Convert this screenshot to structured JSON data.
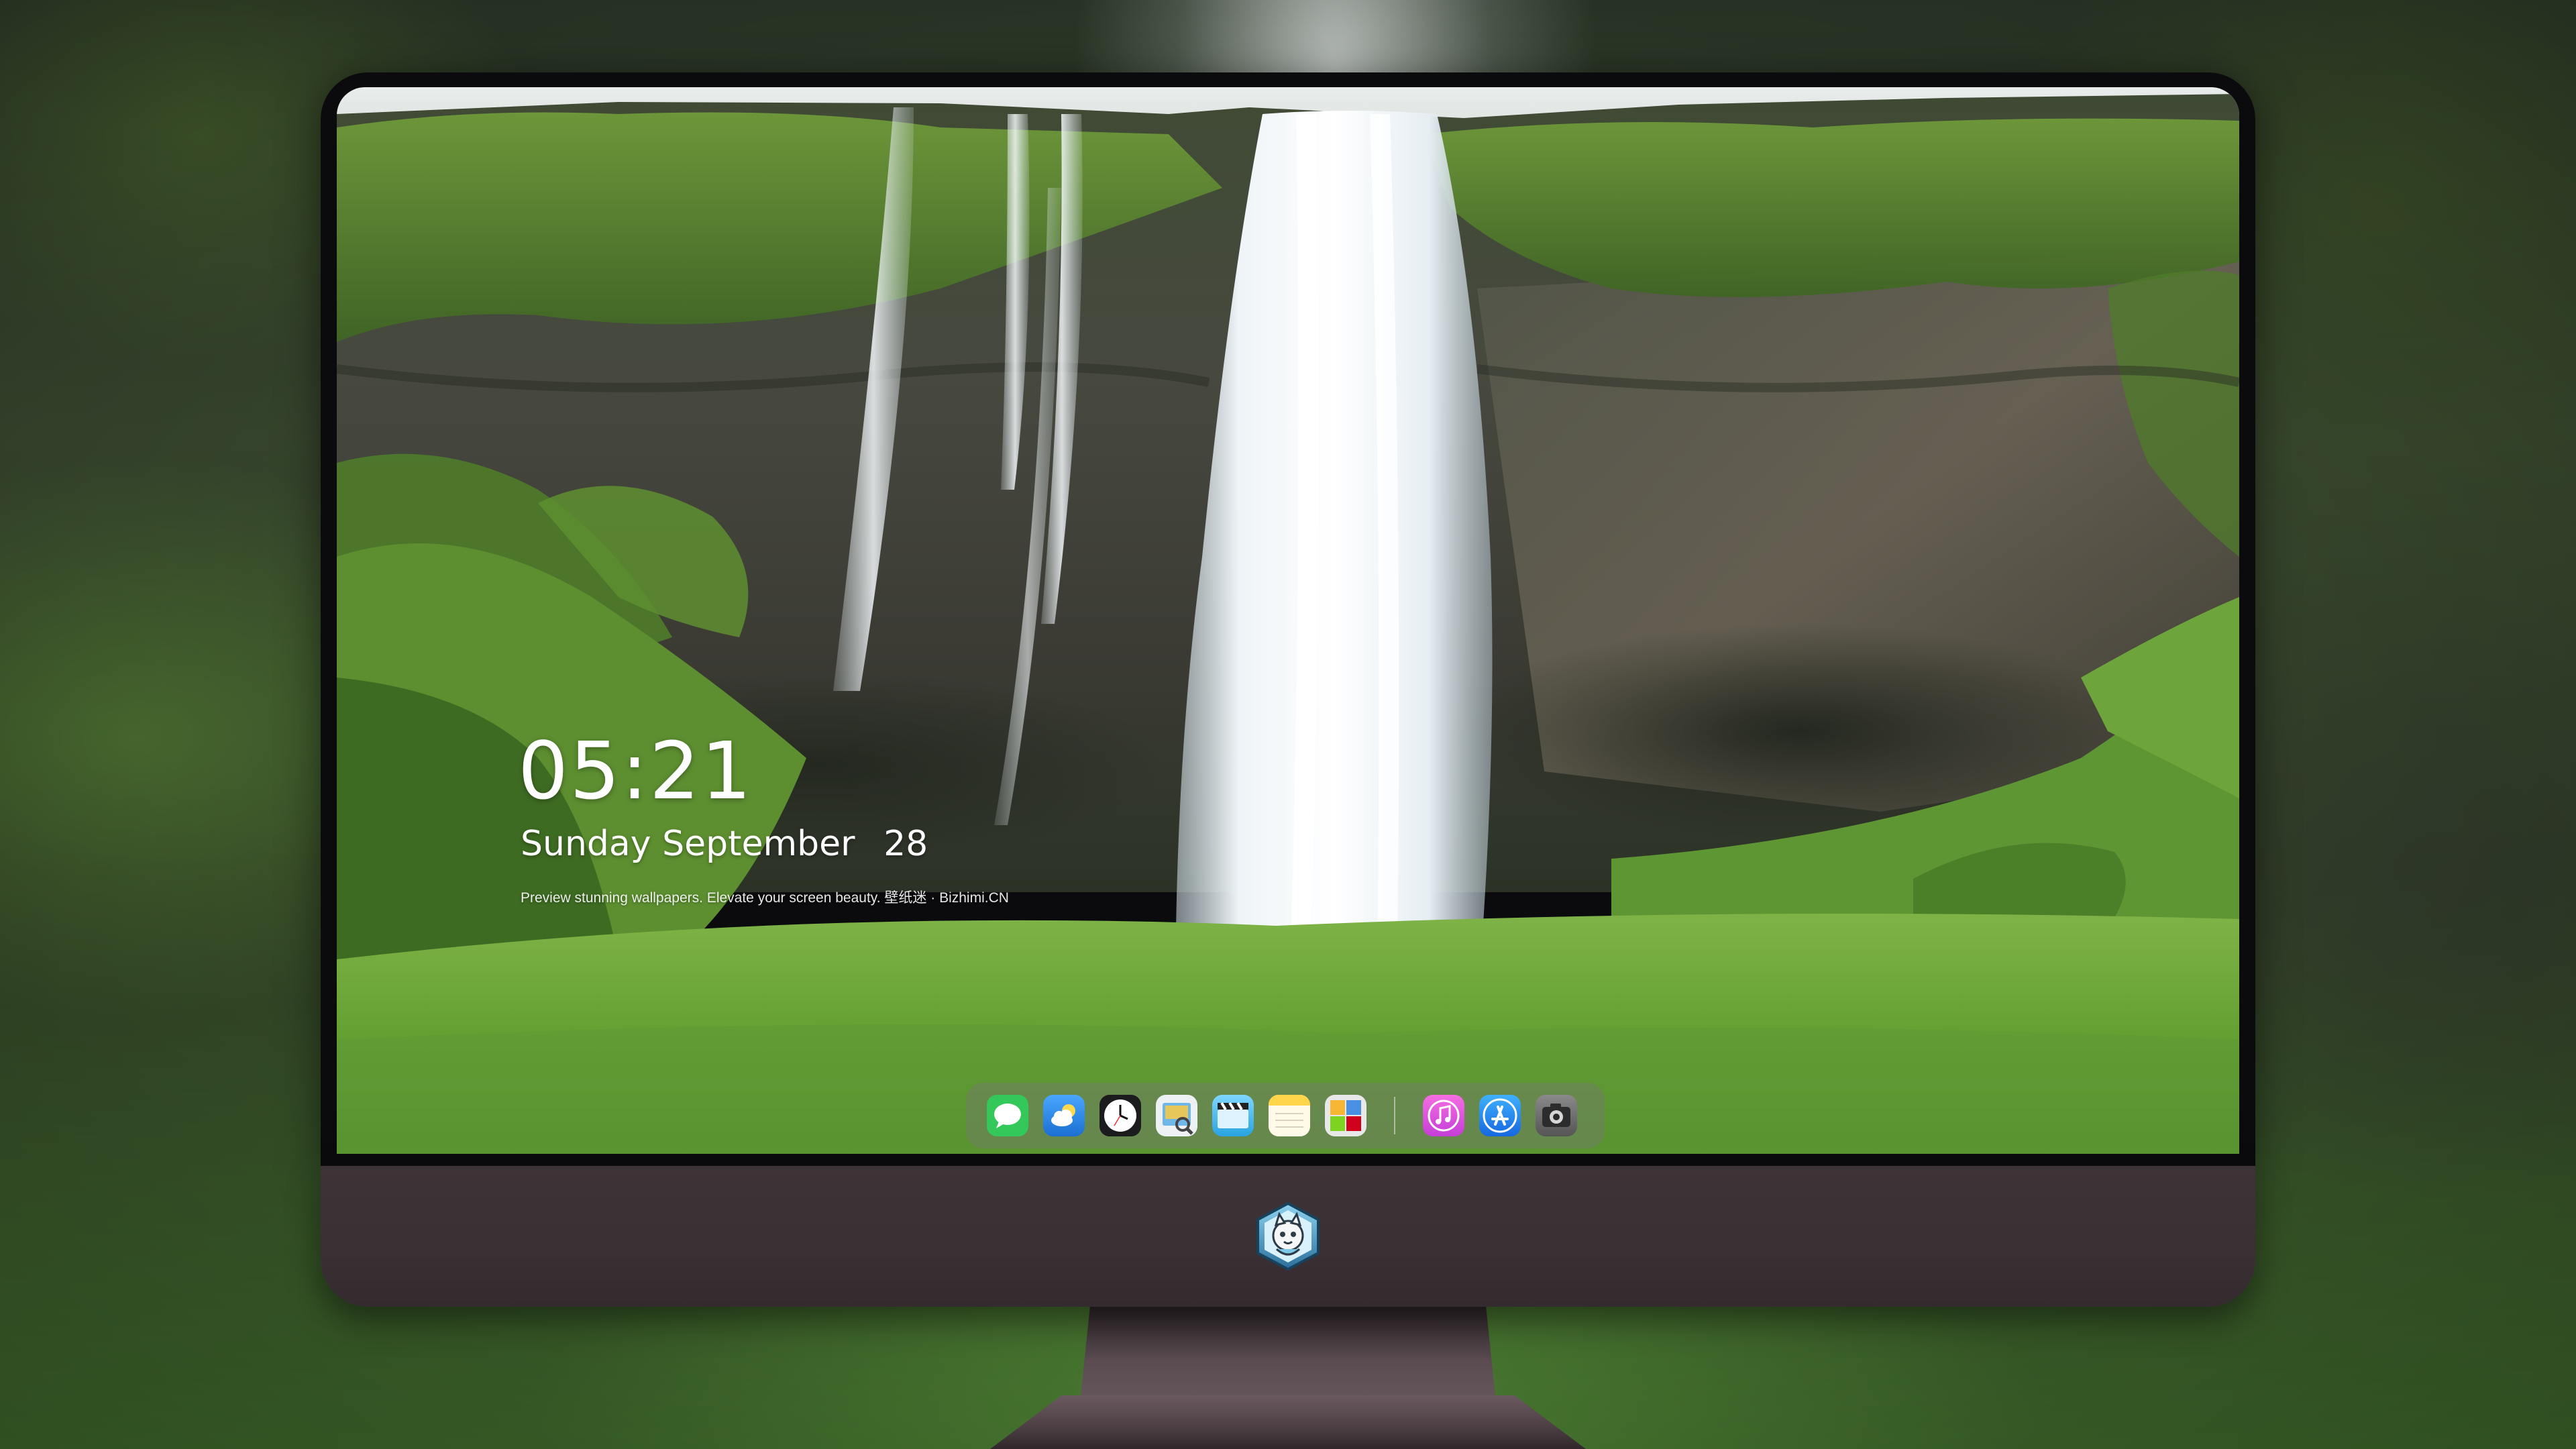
{
  "lock_screen": {
    "time": "05:21",
    "day_of_week": "Sunday",
    "month": "September",
    "day": "28",
    "tagline": "Preview stunning wallpapers. Elevate your screen beauty. 壁纸迷 · Bizhimi.CN"
  },
  "dock": {
    "apps": [
      {
        "icon": "messages-icon",
        "color": "#34c759"
      },
      {
        "icon": "weather-icon",
        "color": "#2d8cf0"
      },
      {
        "icon": "clock-icon",
        "color": "#1c1c1e"
      },
      {
        "icon": "preview-icon",
        "color": "#f2f2f2"
      },
      {
        "icon": "clips-icon",
        "color": "#5ac8fa"
      },
      {
        "icon": "notes-icon",
        "color": "#ffd54a"
      },
      {
        "icon": "photo-booth-icon",
        "color": "#e8e8e8"
      }
    ],
    "apps_after_separator": [
      {
        "icon": "itunes-icon",
        "color": "#e64fd5"
      },
      {
        "icon": "app-store-icon",
        "color": "#1e8cf7"
      },
      {
        "icon": "screenshot-icon",
        "color": "#6e6e6e"
      }
    ]
  },
  "colors": {
    "monitor_chin": "#3a3034",
    "bezel": "#0b0b0d",
    "grass": "#5f9a35"
  }
}
